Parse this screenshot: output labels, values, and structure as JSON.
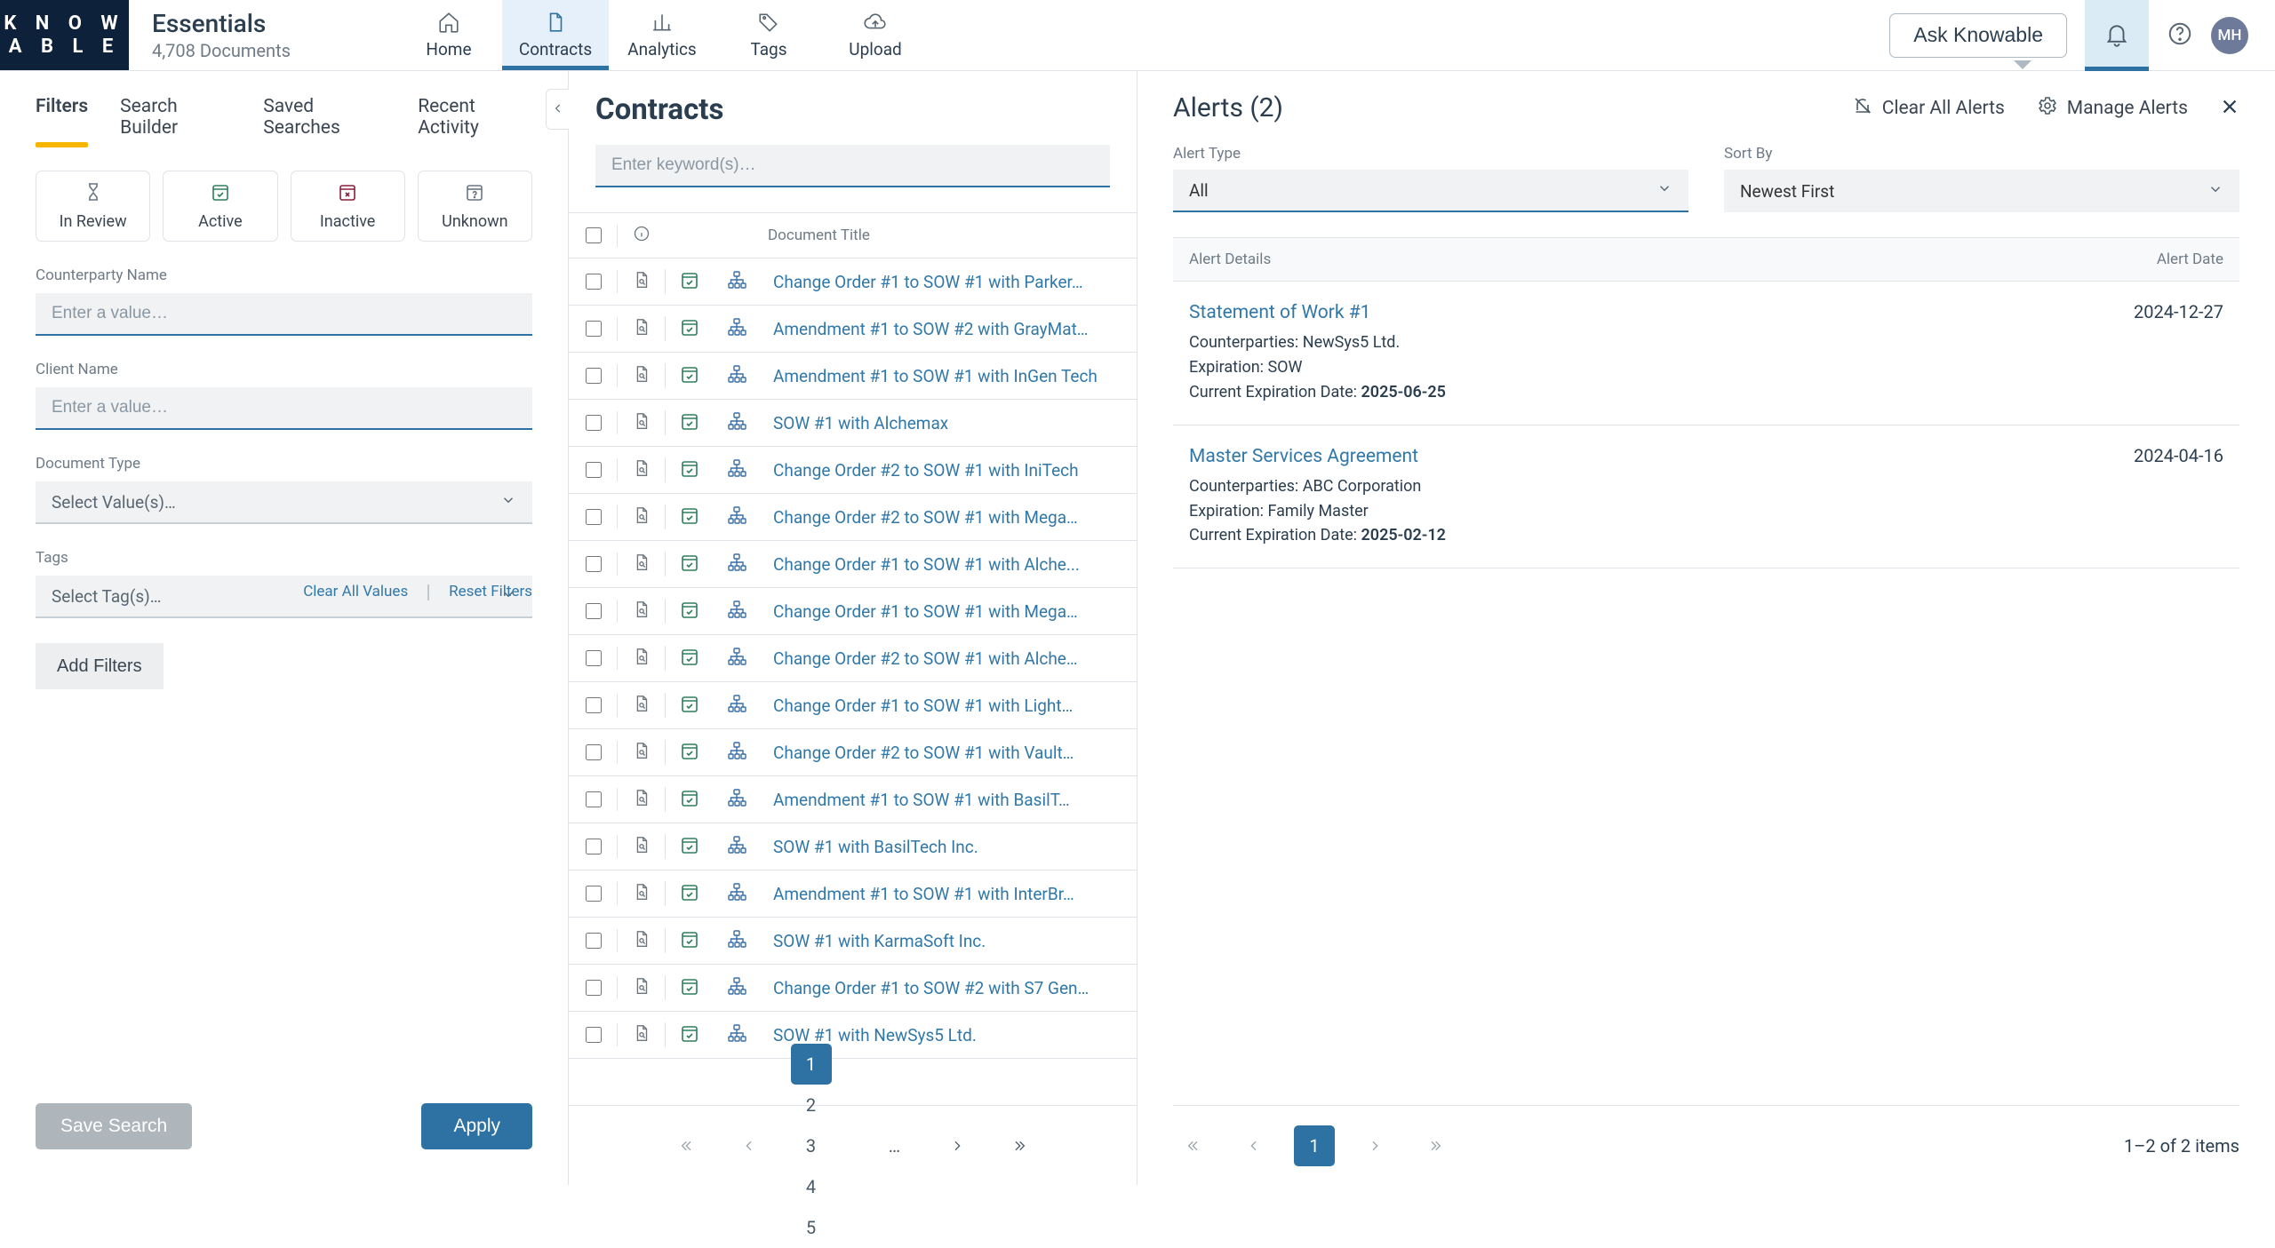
{
  "brand": {
    "logo_top": "K N O W",
    "logo_bottom": "A B L E",
    "title": "Essentials",
    "subtitle": "4,708 Documents"
  },
  "topnav": {
    "items": [
      {
        "label": "Home"
      },
      {
        "label": "Contracts"
      },
      {
        "label": "Analytics"
      },
      {
        "label": "Tags"
      },
      {
        "label": "Upload"
      }
    ],
    "active_index": 1
  },
  "header": {
    "ask_label": "Ask Knowable",
    "avatar_initials": "MH"
  },
  "sidebar": {
    "tabs": [
      {
        "label": "Filters"
      },
      {
        "label": "Search Builder"
      },
      {
        "label": "Saved Searches"
      },
      {
        "label": "Recent Activity"
      }
    ],
    "active_tab": 0,
    "status": {
      "in_review": "In Review",
      "active": "Active",
      "inactive": "Inactive",
      "unknown": "Unknown"
    },
    "filters": {
      "counterparty_label": "Counterparty Name",
      "counterparty_placeholder": "Enter a value…",
      "client_label": "Client Name",
      "client_placeholder": "Enter a value…",
      "doctype_label": "Document Type",
      "doctype_placeholder": "Select Value(s)…",
      "tags_label": "Tags",
      "tags_placeholder": "Select Tag(s)…"
    },
    "add_filters": "Add Filters",
    "clear_values": "Clear All Values",
    "reset_filters": "Reset Filters",
    "save_search": "Save Search",
    "apply": "Apply"
  },
  "contracts": {
    "title": "Contracts",
    "keyword_placeholder": "Enter keyword(s)…",
    "col_title": "Document Title",
    "rows": [
      {
        "title": "Change Order #1 to SOW #1 with Parker…"
      },
      {
        "title": "Amendment #1 to SOW #2 with GrayMat…"
      },
      {
        "title": "Amendment #1 to SOW #1 with InGen Tech"
      },
      {
        "title": "SOW #1 with Alchemax"
      },
      {
        "title": "Change Order #2 to SOW #1 with IniTech"
      },
      {
        "title": "Change Order #2 to SOW #1 with Mega…"
      },
      {
        "title": "Change Order #1 to SOW #1 with Alche..."
      },
      {
        "title": "Change Order #1 to SOW #1 with Mega…"
      },
      {
        "title": "Change Order #2 to SOW #1 with Alche…"
      },
      {
        "title": "Change Order #1 to SOW #1 with Light…"
      },
      {
        "title": "Change Order #2 to SOW #1 with Vault…"
      },
      {
        "title": "Amendment #1 to SOW #1 with BasilT…"
      },
      {
        "title": "SOW #1 with BasilTech Inc."
      },
      {
        "title": "Amendment #1 to SOW #1 with InterBr…"
      },
      {
        "title": "SOW #1 with KarmaSoft Inc."
      },
      {
        "title": "Change Order #1 to SOW #2 with S7 Gen…"
      },
      {
        "title": "SOW #1 with NewSys5 Ltd."
      }
    ],
    "pages": [
      "1",
      "2",
      "3",
      "4",
      "5"
    ],
    "ellipsis": "…",
    "active_page": 0
  },
  "alerts": {
    "title": "Alerts (2)",
    "clear_label": "Clear All Alerts",
    "manage_label": "Manage Alerts",
    "type_label": "Alert Type",
    "type_value": "All",
    "sort_label": "Sort By",
    "sort_value": "Newest First",
    "col_details": "Alert Details",
    "col_date": "Alert Date",
    "items": [
      {
        "link": "Statement of Work #1",
        "date": "2024-12-27",
        "counterparties_label": "Counterparties:",
        "counterparties_value": "NewSys5 Ltd.",
        "expiration_label": "Expiration:",
        "expiration_value": "SOW",
        "current_exp_label": "Current Expiration Date:",
        "current_exp_value": "2025-06-25"
      },
      {
        "link": "Master Services Agreement",
        "date": "2024-04-16",
        "counterparties_label": "Counterparties:",
        "counterparties_value": "ABC Corporation",
        "expiration_label": "Expiration:",
        "expiration_value": "Family Master",
        "current_exp_label": "Current Expiration Date:",
        "current_exp_value": "2025-02-12"
      }
    ],
    "footer_count": "1–2 of 2 items",
    "page": "1"
  }
}
